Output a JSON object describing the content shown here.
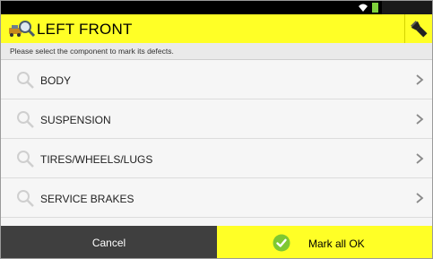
{
  "header": {
    "title": "LEFT FRONT",
    "logo_icon": "vehicle-search-icon",
    "flash_icon": "flashlight-icon",
    "background": "#ffff26"
  },
  "subheader": {
    "text": "Please select the component to mark its defects."
  },
  "components": [
    {
      "label": "BODY",
      "icon": "search-icon"
    },
    {
      "label": "SUSPENSION",
      "icon": "search-icon"
    },
    {
      "label": "TIRES/WHEELS/LUGS",
      "icon": "search-icon"
    },
    {
      "label": "SERVICE BRAKES",
      "icon": "search-icon"
    }
  ],
  "footer": {
    "cancel_label": "Cancel",
    "ok_label": "Mark all OK",
    "cancel_color": "#3f3f3f",
    "ok_color": "#ffff26",
    "ok_icon_color": "#7fc832"
  }
}
